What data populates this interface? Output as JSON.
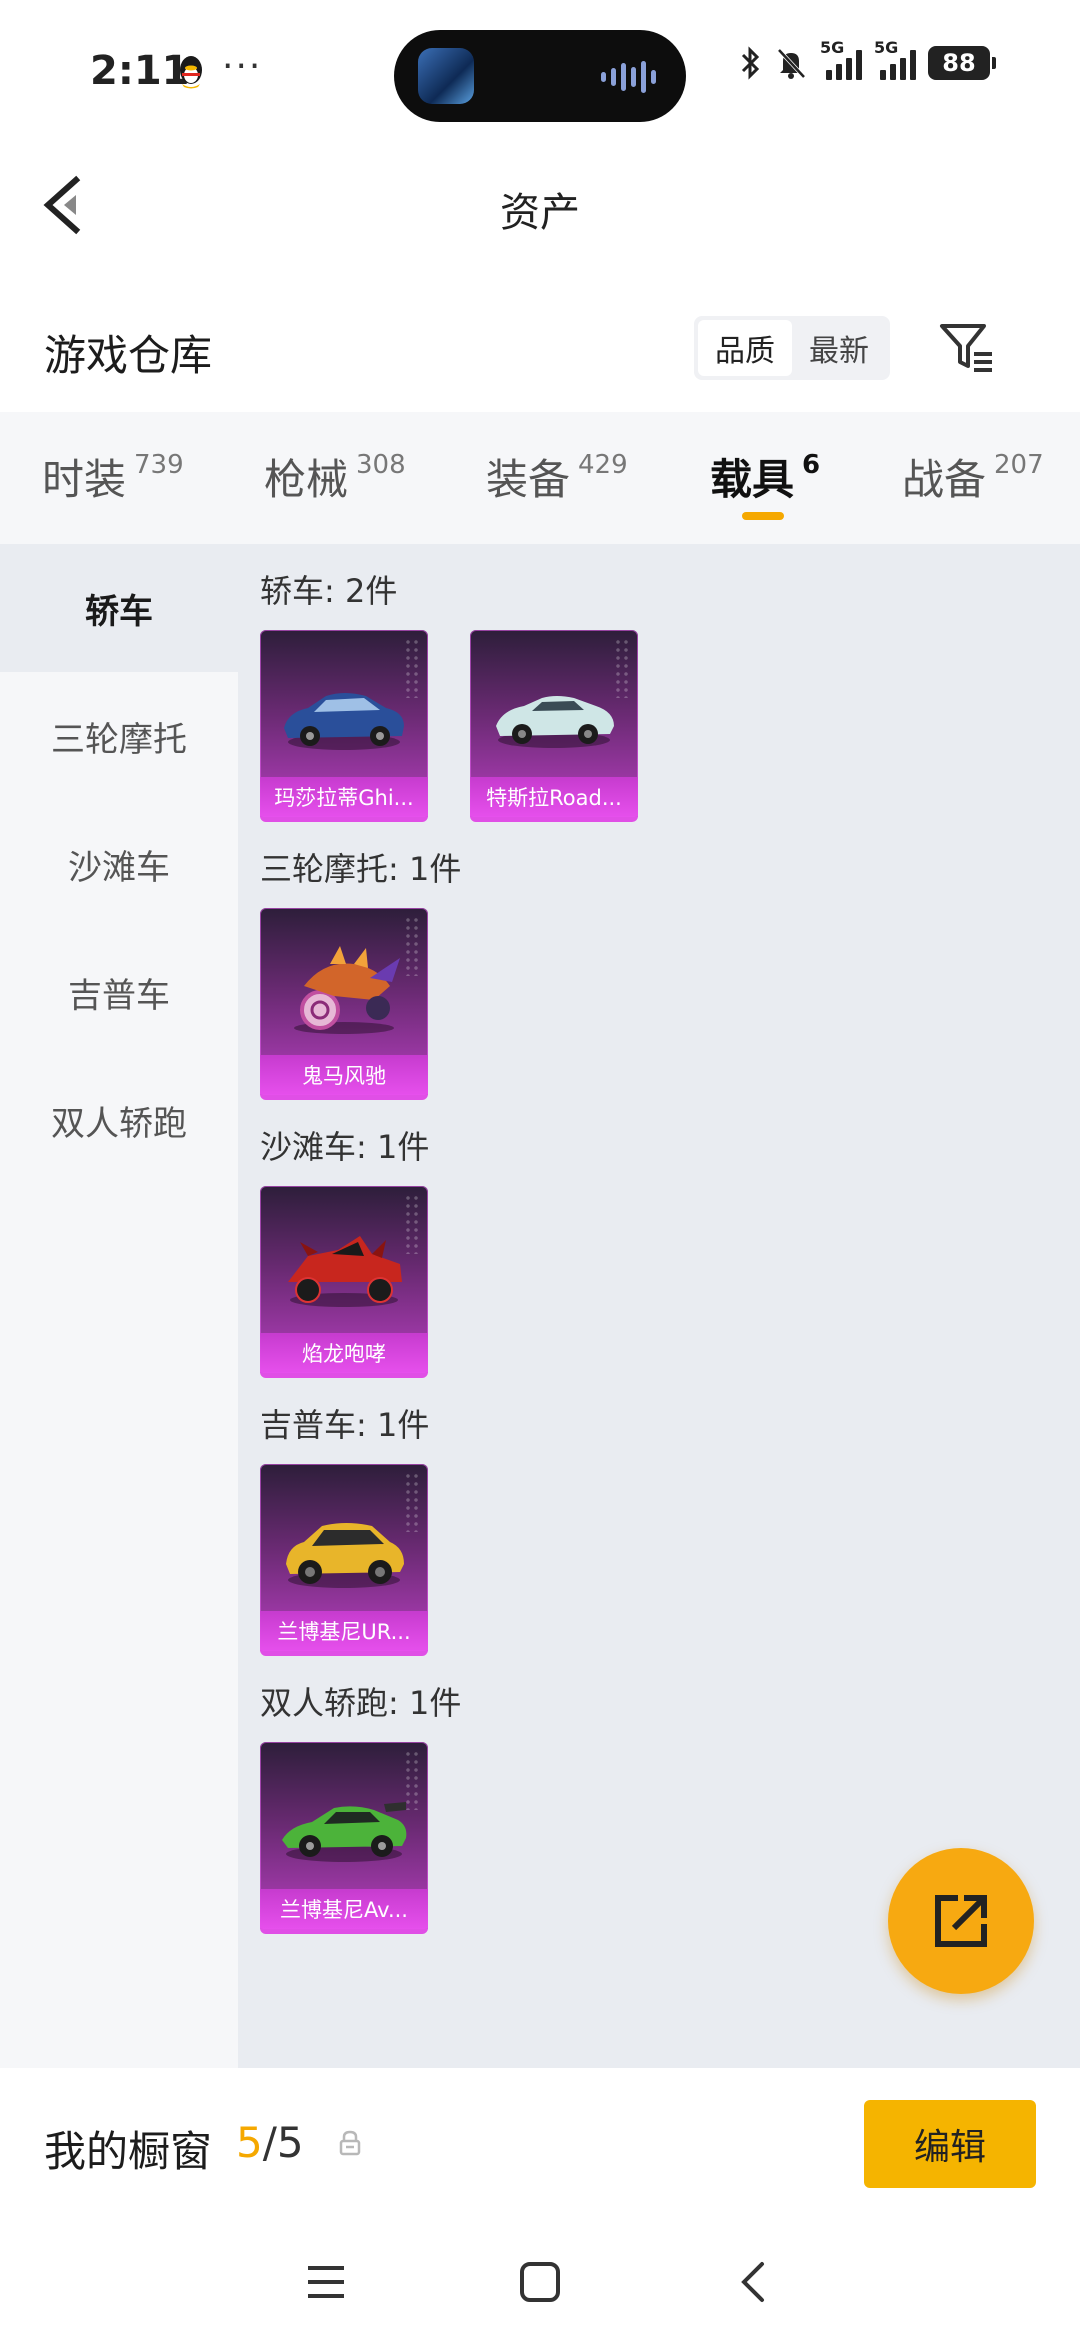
{
  "status_bar": {
    "time": "2:11",
    "more": "···",
    "signal1_tag": "5G",
    "signal2_tag": "5G",
    "battery": "88"
  },
  "header": {
    "title": "资产"
  },
  "warehouse": {
    "title": "游戏仓库",
    "sort_options": [
      "品质",
      "最新"
    ],
    "sort_active": "品质"
  },
  "tabs": [
    {
      "label": "时装",
      "count": "739"
    },
    {
      "label": "枪械",
      "count": "308"
    },
    {
      "label": "装备",
      "count": "429"
    },
    {
      "label": "载具",
      "count": "6"
    },
    {
      "label": "战备",
      "count": "207"
    }
  ],
  "active_tab": "载具",
  "sidebar": [
    {
      "label": "轿车"
    },
    {
      "label": "三轮摩托"
    },
    {
      "label": "沙滩车"
    },
    {
      "label": "吉普车"
    },
    {
      "label": "双人轿跑"
    }
  ],
  "sections": [
    {
      "title": "轿车: 2件",
      "items": [
        {
          "name": "玛莎拉蒂Ghi...",
          "icon": "blue-sports-car-icon"
        },
        {
          "name": "特斯拉Road...",
          "icon": "white-roadster-icon"
        }
      ]
    },
    {
      "title": "三轮摩托: 1件",
      "items": [
        {
          "name": "鬼马风驰",
          "icon": "trike-motorcycle-icon"
        }
      ]
    },
    {
      "title": "沙滩车: 1件",
      "items": [
        {
          "name": "焰龙咆哮",
          "icon": "red-buggy-icon"
        }
      ]
    },
    {
      "title": "吉普车: 1件",
      "items": [
        {
          "name": "兰博基尼UR...",
          "icon": "yellow-suv-icon"
        }
      ]
    },
    {
      "title": "双人轿跑: 1件",
      "items": [
        {
          "name": "兰博基尼Av...",
          "icon": "green-supercar-icon"
        }
      ]
    }
  ],
  "showcase": {
    "label": "我的橱窗",
    "current": "5",
    "separator": "/",
    "max": "5",
    "edit_label": "编辑"
  },
  "colors": {
    "accent": "#f5a800",
    "card_purple": "#b63fbf",
    "content_bg": "#e9ecf1"
  }
}
